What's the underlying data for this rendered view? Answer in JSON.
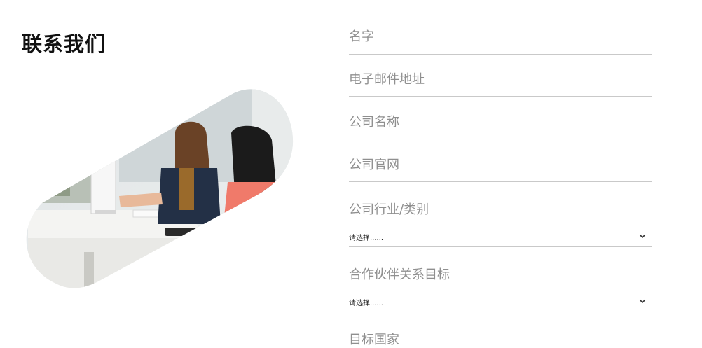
{
  "page": {
    "title": "联系我们"
  },
  "form": {
    "name_placeholder": "名字",
    "email_placeholder": "电子邮件地址",
    "company_name_placeholder": "公司名称",
    "company_website_placeholder": "公司官网",
    "industry": {
      "label": "公司行业/类别",
      "selected": "请选择......"
    },
    "partnership_goal": {
      "label": "合作伙伴关系目标",
      "selected": "请选择......"
    },
    "target_country_label": "目标国家"
  },
  "icons": {
    "dropdown": "chevron-down-icon"
  },
  "colors": {
    "text_dark": "#111111",
    "placeholder": "#8f8f8f",
    "divider": "#c9c9c9",
    "accent_shirt": "#f07a6a"
  }
}
